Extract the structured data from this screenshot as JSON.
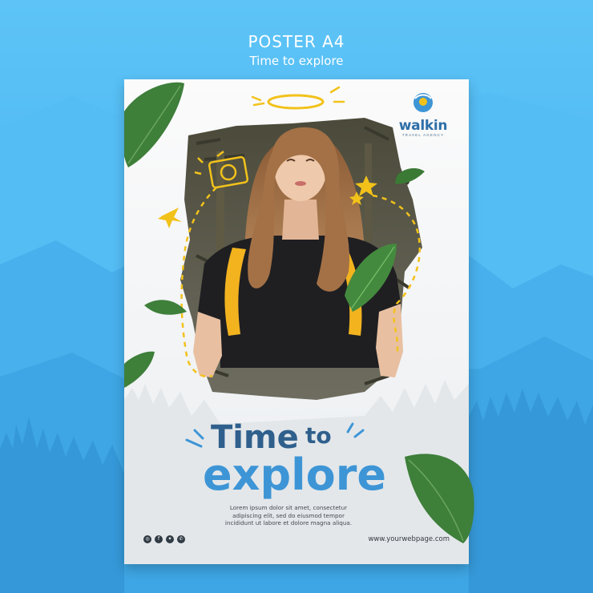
{
  "header": {
    "title": "POSTER A4",
    "subtitle": "Time to explore"
  },
  "logo": {
    "brand_walk": "walk",
    "brand_in": "in",
    "tagline": "TRAVEL AGENCY"
  },
  "headline": {
    "line1_word1": "Time",
    "line1_word2": "to",
    "line2": "explore"
  },
  "body": {
    "line1": "Lorem ipsum dolor sit amet, consectetur",
    "line2": "adipiscing elit, sed do eiusmod tempor",
    "line3": "incididunt ut labore et dolore magna aliqua."
  },
  "footer": {
    "website": "www.yourwebpage.com",
    "social_icons": [
      "instagram-icon",
      "facebook-icon",
      "twitter-icon",
      "whatsapp-icon"
    ]
  },
  "colors": {
    "background": "#46b4f0",
    "headline_dark": "#2f5f8c",
    "headline_light": "#3d95d6",
    "doodle_yellow": "#f2c21b",
    "backpack_yellow": "#f2b31f",
    "leaf_green": "#3e7f3a"
  }
}
